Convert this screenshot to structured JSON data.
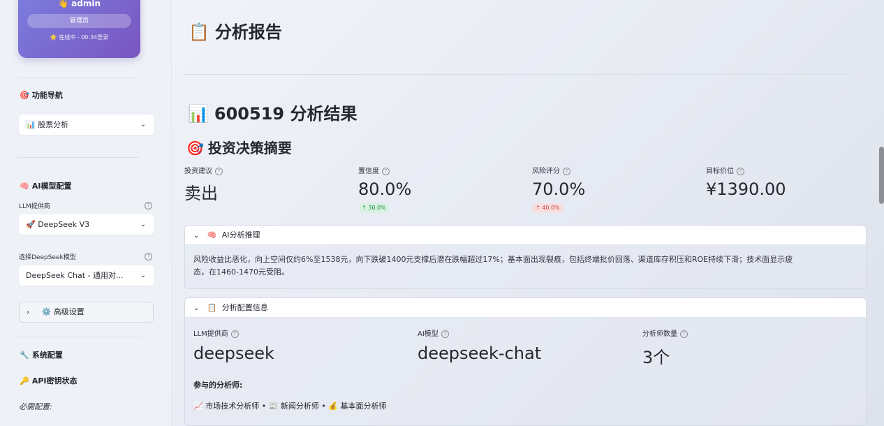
{
  "sidebar": {
    "user": {
      "name": "👋 admin",
      "role": "管理员",
      "status": "🌟 在线中 - 00:34登录"
    },
    "nav_heading": "功能导航",
    "nav_heading_icon": "🎯",
    "nav_select": {
      "icon": "📊",
      "value": "股票分析"
    },
    "ai_heading": "AI模型配置",
    "ai_heading_icon": "🧠",
    "llm_provider_label": "LLM提供商",
    "llm_provider_select": {
      "icon": "🚀",
      "value": "DeepSeek V3"
    },
    "model_label": "选择DeepSeek模型",
    "model_select": {
      "value": "DeepSeek Chat - 通用对..."
    },
    "advanced_settings": {
      "icon": "⚙️",
      "label": "高级设置"
    },
    "system_config_heading": "系统配置",
    "system_config_icon": "🔧",
    "api_status_heading": "API密钥状态",
    "api_status_icon": "🔑",
    "required_config_label": "必需配置:"
  },
  "main": {
    "page_title": "分析报告",
    "page_title_icon": "📋",
    "result_title": "600519 分析结果",
    "result_title_icon": "📊",
    "summary_title": "投资决策摘要",
    "summary_title_icon": "🎯",
    "metrics": [
      {
        "label": "投资建议",
        "value": "卖出",
        "delta": ""
      },
      {
        "label": "置信度",
        "value": "80.0%",
        "delta": "↑ 30.0%",
        "delta_dir": "up"
      },
      {
        "label": "风险评分",
        "value": "70.0%",
        "delta": "↑ 40.0%",
        "delta_dir": "down"
      },
      {
        "label": "目标价位",
        "value": "¥1390.00",
        "delta": ""
      }
    ],
    "reasoning_expander": {
      "icon": "🧠",
      "title": "AI分析推理",
      "text_line1": "风险收益比恶化，向上空间仅约6%至1538元，向下跌破1400元支撑后潜在跌幅超过17%；基本面出现裂痕，包括终端批价回落、渠道库存积压和ROE持续下滑；技术面显示疲",
      "text_line2": "态，在1460-1470元受阻。"
    },
    "config_expander": {
      "icon": "📋",
      "title": "分析配置信息",
      "metrics": [
        {
          "label": "LLM提供商",
          "value": "deepseek"
        },
        {
          "label": "AI模型",
          "value": "deepseek-chat"
        },
        {
          "label": "分析师数量",
          "value": "3个"
        }
      ],
      "participants_label": "参与的分析师:",
      "participants": "📈 市场技术分析师 • 📰 新闻分析师 • 💰 基本面分析师"
    }
  },
  "colors": {
    "user_card_start": "#7b7fe0",
    "user_card_end": "#7a55c0",
    "delta_up": "#1a8f45",
    "delta_down": "#d03b3b"
  }
}
